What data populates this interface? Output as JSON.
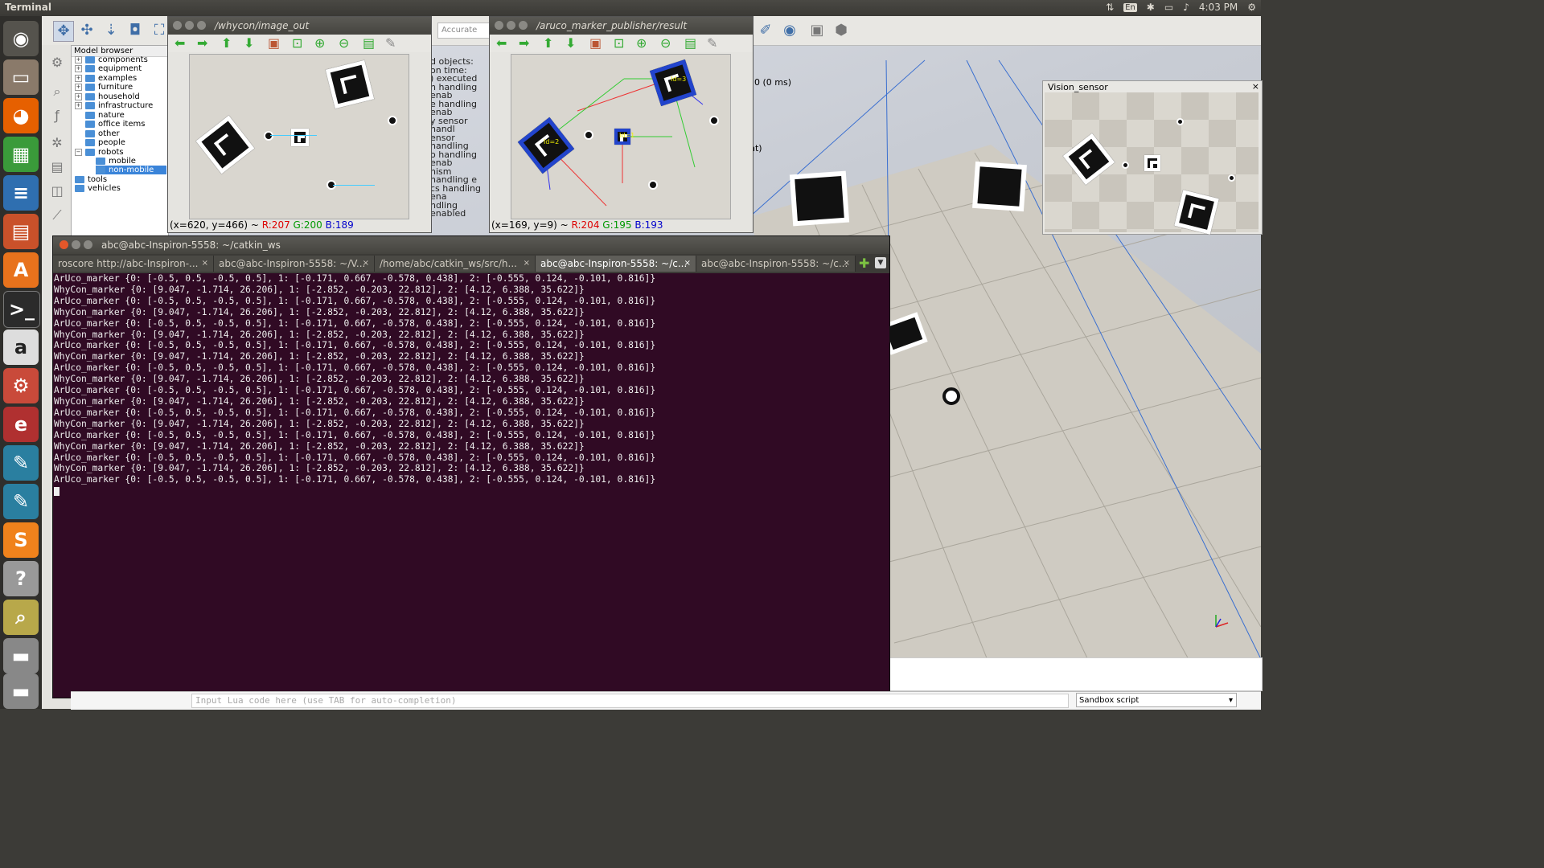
{
  "topbar": {
    "app_title": "Terminal",
    "lang": "En",
    "time": "4:03 PM"
  },
  "launcher": {
    "items": [
      "ubuntu-dash-icon",
      "files-icon",
      "firefox-icon",
      "calc-icon",
      "writer-icon",
      "impress-icon",
      "software-center-icon",
      "terminal-icon",
      "amazon-icon",
      "settings-icon",
      "unknown-app-icon",
      "gazebo-icon",
      "gazebo-icon",
      "sublime-text-icon",
      "help-icon",
      "image-viewer-icon",
      "drive-icon",
      "drive-icon"
    ]
  },
  "model_browser": {
    "header": "Model browser",
    "items": [
      {
        "label": "components",
        "expander": "+"
      },
      {
        "label": "equipment",
        "expander": "+"
      },
      {
        "label": "examples",
        "expander": "+"
      },
      {
        "label": "furniture",
        "expander": "+"
      },
      {
        "label": "household",
        "expander": "+"
      },
      {
        "label": "infrastructure",
        "expander": "+"
      },
      {
        "label": "nature",
        "expander": ""
      },
      {
        "label": "office items",
        "expander": ""
      },
      {
        "label": "other",
        "expander": ""
      },
      {
        "label": "people",
        "expander": ""
      },
      {
        "label": "robots",
        "expander": "−"
      },
      {
        "label": "mobile",
        "expander": ""
      },
      {
        "label": "non-mobile",
        "expander": ""
      },
      {
        "label": "tools",
        "expander": ""
      },
      {
        "label": "vehicles",
        "expander": ""
      }
    ]
  },
  "whycon_viewer": {
    "title": "/whycon/image_out",
    "status_prefix": "(x=620, y=466) ~ ",
    "r": "R:207",
    "g": "G:200",
    "b": "B:189"
  },
  "aruco_viewer": {
    "title": "/aruco_marker_publisher/result",
    "status_prefix": "(x=169, y=9) ~ ",
    "r": "R:204",
    "g": "G:195",
    "b": "B:193",
    "labels": [
      "Id=3",
      "Id=2",
      "Id=1"
    ]
  },
  "sim_toolbar": {
    "accuracy": "Accurate (def"
  },
  "sim_log": {
    "lines": [
      "d objects:",
      "on time:",
      ") executed",
      "n handling enab",
      "e handling enab",
      "y sensor handl",
      "ensor handling",
      "o handling enab",
      "nism handling e",
      "cs handling ena",
      "ndling enabled"
    ],
    "timing": "0 (0 ms)",
    "extra": "nt)"
  },
  "vision_sensor": {
    "title": "Vision_sensor"
  },
  "terminal": {
    "title": "abc@abc-Inspiron-5558: ~/catkin_ws",
    "tabs": [
      "roscore http://abc-Inspiron-...",
      "abc@abc-Inspiron-5558: ~/V...",
      "/home/abc/catkin_ws/src/h...",
      "abc@abc-Inspiron-5558: ~/c...",
      "abc@abc-Inspiron-5558: ~/c..."
    ],
    "lines": [
      "ArUco_marker {0: [-0.5, 0.5, -0.5, 0.5], 1: [-0.171, 0.667, -0.578, 0.438], 2: [-0.555, 0.124, -0.101, 0.816]}",
      "",
      "",
      "WhyCon_marker {0: [9.047, -1.714, 26.206], 1: [-2.852, -0.203, 22.812], 2: [4.12, 6.388, 35.622]}",
      "ArUco_marker {0: [-0.5, 0.5, -0.5, 0.5], 1: [-0.171, 0.667, -0.578, 0.438], 2: [-0.555, 0.124, -0.101, 0.816]}",
      "",
      "",
      "WhyCon_marker {0: [9.047, -1.714, 26.206], 1: [-2.852, -0.203, 22.812], 2: [4.12, 6.388, 35.622]}",
      "ArUco_marker {0: [-0.5, 0.5, -0.5, 0.5], 1: [-0.171, 0.667, -0.578, 0.438], 2: [-0.555, 0.124, -0.101, 0.816]}",
      "",
      "",
      "WhyCon_marker {0: [9.047, -1.714, 26.206], 1: [-2.852, -0.203, 22.812], 2: [4.12, 6.388, 35.622]}",
      "ArUco_marker {0: [-0.5, 0.5, -0.5, 0.5], 1: [-0.171, 0.667, -0.578, 0.438], 2: [-0.555, 0.124, -0.101, 0.816]}",
      "",
      "",
      "WhyCon_marker {0: [9.047, -1.714, 26.206], 1: [-2.852, -0.203, 22.812], 2: [4.12, 6.388, 35.622]}",
      "ArUco_marker {0: [-0.5, 0.5, -0.5, 0.5], 1: [-0.171, 0.667, -0.578, 0.438], 2: [-0.555, 0.124, -0.101, 0.816]}",
      "",
      "",
      "WhyCon_marker {0: [9.047, -1.714, 26.206], 1: [-2.852, -0.203, 22.812], 2: [4.12, 6.388, 35.622]}",
      "ArUco_marker {0: [-0.5, 0.5, -0.5, 0.5], 1: [-0.171, 0.667, -0.578, 0.438], 2: [-0.555, 0.124, -0.101, 0.816]}",
      "",
      "",
      "WhyCon_marker {0: [9.047, -1.714, 26.206], 1: [-2.852, -0.203, 22.812], 2: [4.12, 6.388, 35.622]}",
      "ArUco_marker {0: [-0.5, 0.5, -0.5, 0.5], 1: [-0.171, 0.667, -0.578, 0.438], 2: [-0.555, 0.124, -0.101, 0.816]}",
      "",
      "",
      "WhyCon_marker {0: [9.047, -1.714, 26.206], 1: [-2.852, -0.203, 22.812], 2: [4.12, 6.388, 35.622]}",
      "ArUco_marker {0: [-0.5, 0.5, -0.5, 0.5], 1: [-0.171, 0.667, -0.578, 0.438], 2: [-0.555, 0.124, -0.101, 0.816]}",
      "",
      "",
      "WhyCon_marker {0: [9.047, -1.714, 26.206], 1: [-2.852, -0.203, 22.812], 2: [4.12, 6.388, 35.622]}",
      "ArUco_marker {0: [-0.5, 0.5, -0.5, 0.5], 1: [-0.171, 0.667, -0.578, 0.438], 2: [-0.555, 0.124, -0.101, 0.816]}",
      "",
      "",
      "WhyCon_marker {0: [9.047, -1.714, 26.206], 1: [-2.852, -0.203, 22.812], 2: [4.12, 6.388, 35.622]}",
      "ArUco_marker {0: [-0.5, 0.5, -0.5, 0.5], 1: [-0.171, 0.667, -0.578, 0.438], 2: [-0.555, 0.124, -0.101, 0.816]}"
    ]
  },
  "lua_bar": {
    "placeholder": "Input Lua code here (use TAB for auto-completion)",
    "script_select": "Sandbox script"
  }
}
